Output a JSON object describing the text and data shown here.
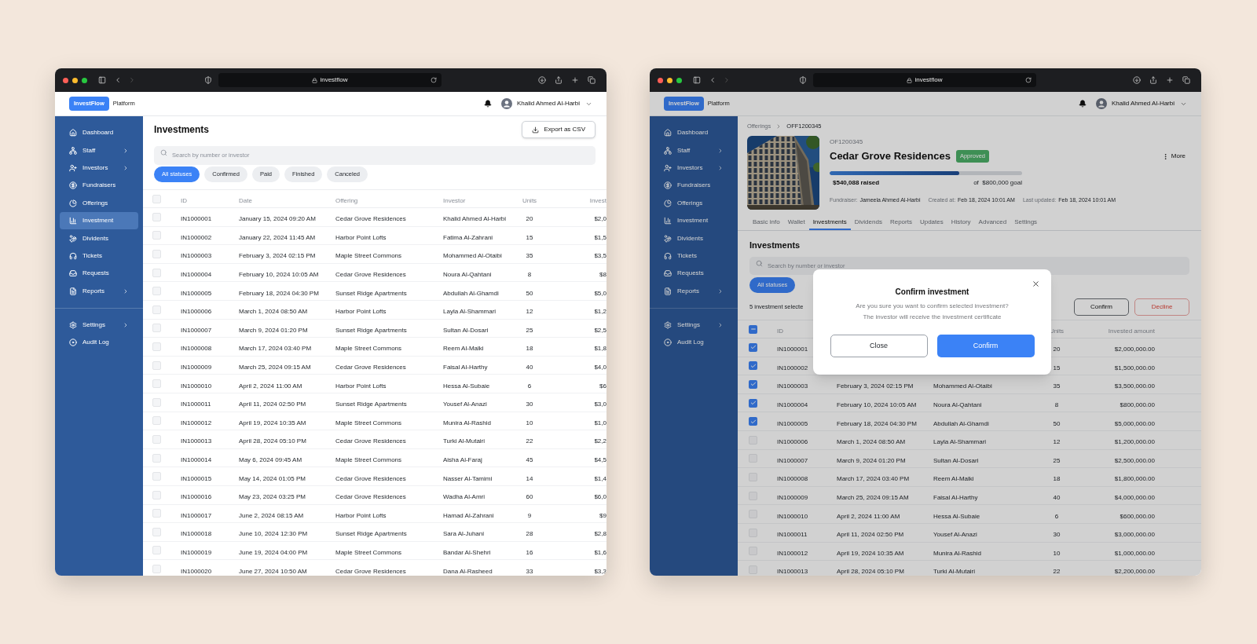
{
  "list_window": {
    "browser": {
      "url": "investflow"
    },
    "app_header": {
      "logo": "InvestFlow",
      "product": "Platform",
      "user": "Khalid Ahmed Al-Harbi"
    },
    "sidebar": {
      "items": [
        {
          "label": "Dashboard",
          "has_submenu": false,
          "selected": false
        },
        {
          "label": "Staff",
          "has_submenu": true,
          "selected": false
        },
        {
          "label": "Investors",
          "has_submenu": true,
          "selected": false
        },
        {
          "label": "Fundraisers",
          "has_submenu": false,
          "selected": false
        },
        {
          "label": "Offerings",
          "has_submenu": false,
          "selected": false
        },
        {
          "label": "Investment",
          "has_submenu": false,
          "selected": true
        },
        {
          "label": "Dividents",
          "has_submenu": false,
          "selected": false
        },
        {
          "label": "Tickets",
          "has_submenu": false,
          "selected": false
        },
        {
          "label": "Requests",
          "has_submenu": false,
          "selected": false
        },
        {
          "label": "Reports",
          "has_submenu": true,
          "selected": false
        }
      ],
      "bottom_items": [
        {
          "label": "Settings",
          "has_submenu": true,
          "selected": false
        },
        {
          "label": "Audit Log",
          "has_submenu": false,
          "selected": false
        }
      ]
    },
    "page": {
      "title": "Investments",
      "export_button": "Export as CSV",
      "search": {
        "placeholder": "Search by number or investor"
      },
      "status_filters": [
        {
          "label": "All statuses",
          "selected": true
        },
        {
          "label": "Confirmed",
          "selected": false
        },
        {
          "label": "Paid",
          "selected": false
        },
        {
          "label": "Finished",
          "selected": false
        },
        {
          "label": "Canceled",
          "selected": false
        }
      ],
      "table": {
        "all_checked": false,
        "partially_checked": false,
        "columns": {
          "id": "ID",
          "date": "Date",
          "offering": "Offering",
          "investor": "Investor",
          "units": "Units",
          "amount": "Invest"
        },
        "rows": [
          {
            "checked": false,
            "id": "IN1000001",
            "date": "January 15, 2024 09:20 AM",
            "offering": "Cedar Grove Residences",
            "investor": "Khalid Ahmed Al-Harbi",
            "units": "20",
            "amount": "$2,0"
          },
          {
            "checked": false,
            "id": "IN1000002",
            "date": "January 22, 2024 11:45 AM",
            "offering": "Harbor Point Lofts",
            "investor": "Fatima Al-Zahrani",
            "units": "15",
            "amount": "$1,5"
          },
          {
            "checked": false,
            "id": "IN1000003",
            "date": "February 3, 2024 02:15 PM",
            "offering": "Maple Street Commons",
            "investor": "Mohammed Al-Otaibi",
            "units": "35",
            "amount": "$3,5"
          },
          {
            "checked": false,
            "id": "IN1000004",
            "date": "February 10, 2024 10:05 AM",
            "offering": "Cedar Grove Residences",
            "investor": "Noura Al-Qahtani",
            "units": "8",
            "amount": "$8"
          },
          {
            "checked": false,
            "id": "IN1000005",
            "date": "February 18, 2024 04:30 PM",
            "offering": "Sunset Ridge Apartments",
            "investor": "Abdullah Al-Ghamdi",
            "units": "50",
            "amount": "$5,0"
          },
          {
            "checked": false,
            "id": "IN1000006",
            "date": "March 1, 2024 08:50 AM",
            "offering": "Harbor Point Lofts",
            "investor": "Layla Al-Shammari",
            "units": "12",
            "amount": "$1,2"
          },
          {
            "checked": false,
            "id": "IN1000007",
            "date": "March 9, 2024 01:20 PM",
            "offering": "Sunset Ridge Apartments",
            "investor": "Sultan Al-Dosari",
            "units": "25",
            "amount": "$2,5"
          },
          {
            "checked": false,
            "id": "IN1000008",
            "date": "March 17, 2024 03:40 PM",
            "offering": "Maple Street Commons",
            "investor": "Reem Al-Malki",
            "units": "18",
            "amount": "$1,8"
          },
          {
            "checked": false,
            "id": "IN1000009",
            "date": "March 25, 2024 09:15 AM",
            "offering": "Cedar Grove Residences",
            "investor": "Faisal Al-Harthy",
            "units": "40",
            "amount": "$4,0"
          },
          {
            "checked": false,
            "id": "IN1000010",
            "date": "April 2, 2024 11:00 AM",
            "offering": "Harbor Point Lofts",
            "investor": "Hessa Al-Subaie",
            "units": "6",
            "amount": "$6"
          },
          {
            "checked": false,
            "id": "IN1000011",
            "date": "April 11, 2024 02:50 PM",
            "offering": "Sunset Ridge Apartments",
            "investor": "Yousef Al-Anazi",
            "units": "30",
            "amount": "$3,0"
          },
          {
            "checked": false,
            "id": "IN1000012",
            "date": "April 19, 2024 10:35 AM",
            "offering": "Maple Street Commons",
            "investor": "Munira Al-Rashid",
            "units": "10",
            "amount": "$1,0"
          },
          {
            "checked": false,
            "id": "IN1000013",
            "date": "April 28, 2024 05:10 PM",
            "offering": "Cedar Grove Residences",
            "investor": "Turki Al-Mutairi",
            "units": "22",
            "amount": "$2,2"
          },
          {
            "checked": false,
            "id": "IN1000014",
            "date": "May 6, 2024 09:45 AM",
            "offering": "Maple Street Commons",
            "investor": "Aisha Al-Faraj",
            "units": "45",
            "amount": "$4,5"
          },
          {
            "checked": false,
            "id": "IN1000015",
            "date": "May 14, 2024 01:05 PM",
            "offering": "Cedar Grove Residences",
            "investor": "Nasser Al-Tamimi",
            "units": "14",
            "amount": "$1,4"
          },
          {
            "checked": false,
            "id": "IN1000016",
            "date": "May 23, 2024 03:25 PM",
            "offering": "Cedar Grove Residences",
            "investor": "Wadha Al-Amri",
            "units": "60",
            "amount": "$6,0"
          },
          {
            "checked": false,
            "id": "IN1000017",
            "date": "June 2, 2024 08:15 AM",
            "offering": "Harbor Point Lofts",
            "investor": "Hamad Al-Zahrani",
            "units": "9",
            "amount": "$9"
          },
          {
            "checked": false,
            "id": "IN1000018",
            "date": "June 10, 2024 12:30 PM",
            "offering": "Sunset Ridge Apartments",
            "investor": "Sara Al-Juhani",
            "units": "28",
            "amount": "$2,8"
          },
          {
            "checked": false,
            "id": "IN1000019",
            "date": "June 19, 2024 04:00 PM",
            "offering": "Maple Street Commons",
            "investor": "Bandar Al-Shehri",
            "units": "16",
            "amount": "$1,6"
          },
          {
            "checked": false,
            "id": "IN1000020",
            "date": "June 27, 2024 10:50 AM",
            "offering": "Cedar Grove Residences",
            "investor": "Dana Al-Rasheed",
            "units": "33",
            "amount": "$3,3"
          }
        ]
      }
    }
  },
  "detail_window": {
    "browser": {
      "url": "investflow"
    },
    "app_header": {
      "logo": "InvestFlow",
      "product": "Platform",
      "user": "Khalid Ahmed Al-Harbi"
    },
    "sidebar": {
      "items": [
        {
          "label": "Dashboard",
          "has_submenu": false,
          "selected": false
        },
        {
          "label": "Staff",
          "has_submenu": true,
          "selected": false
        },
        {
          "label": "Investors",
          "has_submenu": true,
          "selected": false
        },
        {
          "label": "Fundraisers",
          "has_submenu": false,
          "selected": false
        },
        {
          "label": "Offerings",
          "has_submenu": false,
          "selected": false
        },
        {
          "label": "Investment",
          "has_submenu": false,
          "selected": false
        },
        {
          "label": "Dividents",
          "has_submenu": false,
          "selected": false
        },
        {
          "label": "Tickets",
          "has_submenu": false,
          "selected": false
        },
        {
          "label": "Requests",
          "has_submenu": false,
          "selected": false
        },
        {
          "label": "Reports",
          "has_submenu": true,
          "selected": false
        }
      ],
      "bottom_items": [
        {
          "label": "Settings",
          "has_submenu": true,
          "selected": false
        },
        {
          "label": "Audit Log",
          "has_submenu": false,
          "selected": false
        }
      ]
    },
    "page": {
      "breadcrumb": [
        "Offerings",
        "OFF1200345"
      ],
      "offering": {
        "code": "OF1200345",
        "name": "Cedar Grove Residences",
        "status": "Approved",
        "more_button": "More",
        "progress": {
          "level": 0.675,
          "raised": "$540,088 raised",
          "goal": "of  $800,000 goal"
        },
        "meta": [
          {
            "label": "Fundraiser:",
            "value": "Jameela Ahmed Al-Harbi"
          },
          {
            "label": "Created at:",
            "value": "Feb 18, 2024 10:01 AM"
          },
          {
            "label": "Last updated:",
            "value": "Feb 18, 2024 10:01 AM"
          }
        ]
      },
      "tabs": [
        {
          "label": "Basic info",
          "selected": false
        },
        {
          "label": "Wallet",
          "selected": false
        },
        {
          "label": "Investments",
          "selected": true
        },
        {
          "label": "Dividends",
          "selected": false
        },
        {
          "label": "Reports",
          "selected": false
        },
        {
          "label": "Updates",
          "selected": false
        },
        {
          "label": "History",
          "selected": false
        },
        {
          "label": "Advanced",
          "selected": false
        },
        {
          "label": "Settings",
          "selected": false
        }
      ],
      "section_title": "Investments",
      "search": {
        "placeholder": "Search by number or investor"
      },
      "status_filters": [
        {
          "label": "All statuses",
          "selected": true
        }
      ],
      "selection_text": "5 investment selecte",
      "bulk_actions": [
        {
          "label": "Confirm",
          "kind": "neutral"
        },
        {
          "label": "Decline",
          "kind": "danger"
        }
      ],
      "table": {
        "all_checked": false,
        "partially_checked": true,
        "columns": {
          "id": "ID",
          "units": "Units",
          "amount": "Invested amount"
        },
        "rows": [
          {
            "checked": true,
            "id": "IN1000001",
            "units": "20",
            "amount": "$2,000,000.00"
          },
          {
            "checked": true,
            "id": "IN1000002",
            "units": "15",
            "amount": "$1,500,000.00"
          },
          {
            "checked": true,
            "id": "IN1000003",
            "date": "February 3, 2024 02:15 PM",
            "investor": "Mohammed Al-Otaibi",
            "units": "35",
            "amount": "$3,500,000.00"
          },
          {
            "checked": true,
            "id": "IN1000004",
            "date": "February 10, 2024 10:05 AM",
            "investor": "Noura Al-Qahtani",
            "units": "8",
            "amount": "$800,000.00"
          },
          {
            "checked": true,
            "id": "IN1000005",
            "date": "February 18, 2024 04:30 PM",
            "investor": "Abdullah Al-Ghamdi",
            "units": "50",
            "amount": "$5,000,000.00"
          },
          {
            "checked": false,
            "id": "IN1000006",
            "date": "March 1, 2024 08:50 AM",
            "investor": "Layla Al-Shammari",
            "units": "12",
            "amount": "$1,200,000.00"
          },
          {
            "checked": false,
            "id": "IN1000007",
            "date": "March 9, 2024 01:20 PM",
            "investor": "Sultan Al-Dosari",
            "units": "25",
            "amount": "$2,500,000.00"
          },
          {
            "checked": false,
            "id": "IN1000008",
            "date": "March 17, 2024 03:40 PM",
            "investor": "Reem Al-Malki",
            "units": "18",
            "amount": "$1,800,000.00"
          },
          {
            "checked": false,
            "id": "IN1000009",
            "date": "March 25, 2024 09:15 AM",
            "investor": "Faisal Al-Harthy",
            "units": "40",
            "amount": "$4,000,000.00"
          },
          {
            "checked": false,
            "id": "IN1000010",
            "date": "April 2, 2024 11:00 AM",
            "investor": "Hessa Al-Subaie",
            "units": "6",
            "amount": "$600,000.00"
          },
          {
            "checked": false,
            "id": "IN1000011",
            "date": "April 11, 2024 02:50 PM",
            "investor": "Yousef Al-Anazi",
            "units": "30",
            "amount": "$3,000,000.00"
          },
          {
            "checked": false,
            "id": "IN1000012",
            "date": "April 19, 2024 10:35 AM",
            "investor": "Munira Al-Rashid",
            "units": "10",
            "amount": "$1,000,000.00"
          },
          {
            "checked": false,
            "id": "IN1000013",
            "date": "April 28, 2024 05:10 PM",
            "investor": "Turki Al-Mutairi",
            "units": "22",
            "amount": "$2,200,000.00"
          }
        ]
      }
    },
    "modal": {
      "title": "Confirm investment",
      "message_lines": [
        "Are you sure you want to confirm selected investment?",
        "The investor will receive the investment certificate"
      ],
      "buttons": [
        {
          "label": "Close",
          "kind": "secondary"
        },
        {
          "label": "Confirm",
          "kind": "primary"
        }
      ]
    }
  }
}
